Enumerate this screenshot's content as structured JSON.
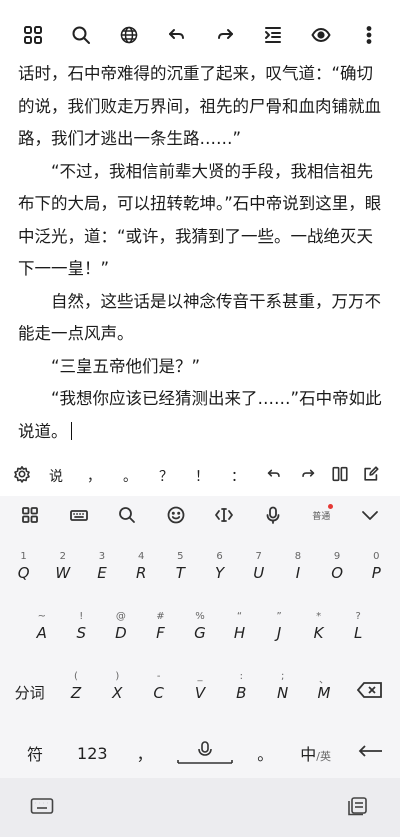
{
  "toolbar": {
    "icons": [
      "grid-icon",
      "search-icon",
      "globe-icon",
      "undo-icon",
      "redo-icon",
      "outline-icon",
      "eye-icon",
      "more-icon"
    ]
  },
  "editor": {
    "line_1": "话时，石中帝难得的沉重了起来，叹气道：“确切的说，我们败走万界间，祖先的尸骨和血肉铺就血路，我们才逃出一条生路……”",
    "para_2": "“不过，我相信前辈大贤的手段，我相信祖先布下的大局，可以扭转乾坤。”石中帝说到这里，眼中泛光，道：“或许，我猜到了一些。一战绝灭天下一一皇！”",
    "para_3": "自然，这些话是以神念传音干系甚重，万万不能走一点风声。",
    "para_4": "“三皇五帝他们是？”",
    "para_5": "“我想你应该已经猜测出来了……”石中帝如此说道。"
  },
  "candidates": {
    "items": [
      "说",
      "，",
      "。",
      "？",
      "！",
      "："
    ]
  },
  "keyboard": {
    "voice_label": "普通",
    "row1": [
      {
        "sub": "1",
        "main": "Q"
      },
      {
        "sub": "2",
        "main": "W"
      },
      {
        "sub": "3",
        "main": "E"
      },
      {
        "sub": "4",
        "main": "R"
      },
      {
        "sub": "5",
        "main": "T"
      },
      {
        "sub": "6",
        "main": "Y"
      },
      {
        "sub": "7",
        "main": "U"
      },
      {
        "sub": "8",
        "main": "I"
      },
      {
        "sub": "9",
        "main": "O"
      },
      {
        "sub": "0",
        "main": "P"
      }
    ],
    "row2": [
      {
        "sub": "~",
        "main": "A"
      },
      {
        "sub": "!",
        "main": "S"
      },
      {
        "sub": "@",
        "main": "D"
      },
      {
        "sub": "#",
        "main": "F"
      },
      {
        "sub": "%",
        "main": "G"
      },
      {
        "sub": "“",
        "main": "H"
      },
      {
        "sub": "”",
        "main": "J"
      },
      {
        "sub": "*",
        "main": "K"
      },
      {
        "sub": "?",
        "main": "L"
      }
    ],
    "row3_left": "分词",
    "row3": [
      {
        "sub": "(",
        "main": "Z"
      },
      {
        "sub": ")",
        "main": "X"
      },
      {
        "sub": "-",
        "main": "C"
      },
      {
        "sub": "_",
        "main": "V"
      },
      {
        "sub": ":",
        "main": "B"
      },
      {
        "sub": ";",
        "main": "N"
      },
      {
        "sub": "、",
        "main": "M"
      }
    ],
    "bottom": {
      "symbols": "符",
      "numbers": "123",
      "comma": "，",
      "period": "。",
      "lang_main": "中",
      "lang_sub": "/英"
    }
  }
}
